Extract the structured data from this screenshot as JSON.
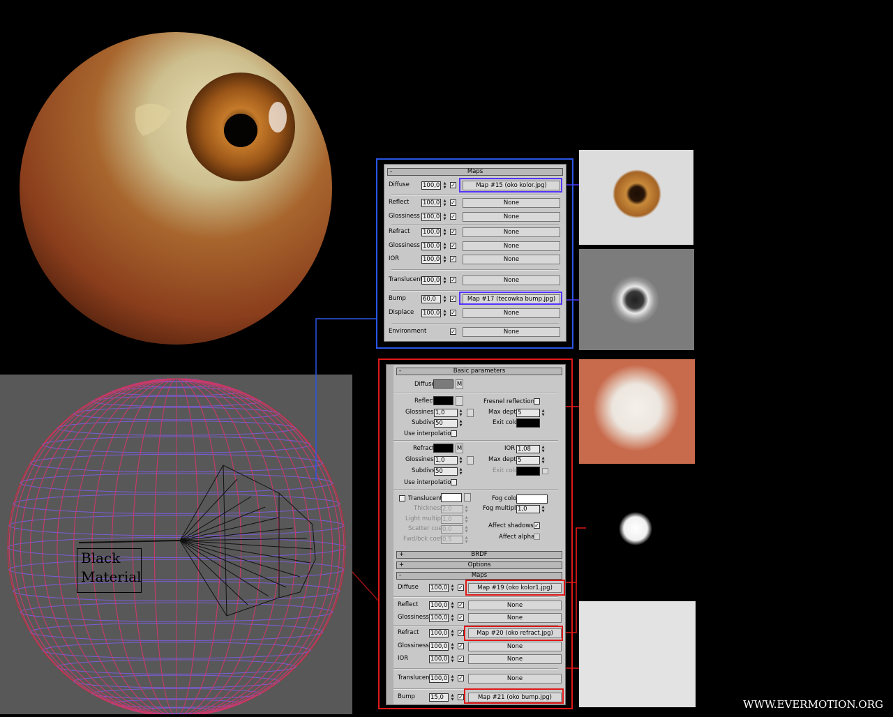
{
  "watermark": "WWW.EVERMOTION.ORG",
  "wireframe": {
    "label_line1": "Black",
    "label_line2": "Material"
  },
  "colors": {
    "blue_frame": "#2a55e6",
    "red_frame": "#e01818",
    "highlight_blue": "#5533ff",
    "panel_bg": "#c8c8c8"
  },
  "maps_panel_1": {
    "rollout": "Maps",
    "rows": [
      {
        "label": "Diffuse",
        "amount": "100,0",
        "map": "Map #15 (oko kolor.jpg)"
      },
      {
        "label": "Reflect",
        "amount": "100,0",
        "map": "None"
      },
      {
        "label": "Glossiness",
        "amount": "100,0",
        "map": "None"
      },
      {
        "label": "Refract",
        "amount": "100,0",
        "map": "None"
      },
      {
        "label": "Glossiness",
        "amount": "100,0",
        "map": "None"
      },
      {
        "label": "IOR",
        "amount": "100,0",
        "map": "None"
      },
      {
        "label": "Translucent",
        "amount": "100,0",
        "map": "None"
      },
      {
        "label": "Bump",
        "amount": "60,0",
        "map": "Map #17 (tecowka bump.jpg)"
      },
      {
        "label": "Displace",
        "amount": "100,0",
        "map": "None"
      },
      {
        "label": "Environment",
        "amount": "",
        "map": "None"
      }
    ]
  },
  "params_panel": {
    "basic_rollout": "Basic parameters",
    "diffuse_label": "Diffuse",
    "m_label": "M",
    "reflect_label": "Reflect",
    "fresnel_label": "Fresnel reflections",
    "glossiness_label": "Glossiness",
    "refl_glossiness": "1,0",
    "max_depth_label": "Max depth",
    "refl_max_depth": "5",
    "subdivs_label": "Subdivs",
    "refl_subdivs": "50",
    "exit_color_label": "Exit color",
    "use_interp_label": "Use interpolation",
    "refract_label": "Refract",
    "ior_label": "IOR",
    "ior_value": "1,08",
    "refr_glossiness": "1,0",
    "refr_max_depth": "5",
    "refr_subdivs": "50",
    "translucent_label": "Translucent",
    "fog_color_label": "Fog color",
    "thickness_label": "Thickness",
    "thickness_value": "2,0",
    "fog_mult_label": "Fog multiplier",
    "fog_mult_value": "1,0",
    "light_mult_label": "Light multiplier",
    "light_mult_value": "1,0",
    "affect_shadows_label": "Affect shadows",
    "scatter_label": "Scatter coeff",
    "scatter_value": "0,0",
    "affect_alpha_label": "Affect alpha",
    "fwd_label": "Fwd/bck coeff",
    "fwd_value": "0,5",
    "brdf_rollout": "BRDF",
    "options_rollout": "Options",
    "maps_rollout": "Maps",
    "rows": [
      {
        "label": "Diffuse",
        "amount": "100,0",
        "map": "Map #19 (oko kolor1.jpg)"
      },
      {
        "label": "Reflect",
        "amount": "100,0",
        "map": "None"
      },
      {
        "label": "Glossiness",
        "amount": "100,0",
        "map": "None"
      },
      {
        "label": "Refract",
        "amount": "100,0",
        "map": "Map #20 (oko refract.jpg)"
      },
      {
        "label": "Glossiness",
        "amount": "100,0",
        "map": "None"
      },
      {
        "label": "IOR",
        "amount": "100,0",
        "map": "None"
      },
      {
        "label": "Translucent",
        "amount": "100,0",
        "map": "None"
      },
      {
        "label": "Bump",
        "amount": "15,0",
        "map": "Map #21 (oko bump.jpg)"
      }
    ]
  }
}
